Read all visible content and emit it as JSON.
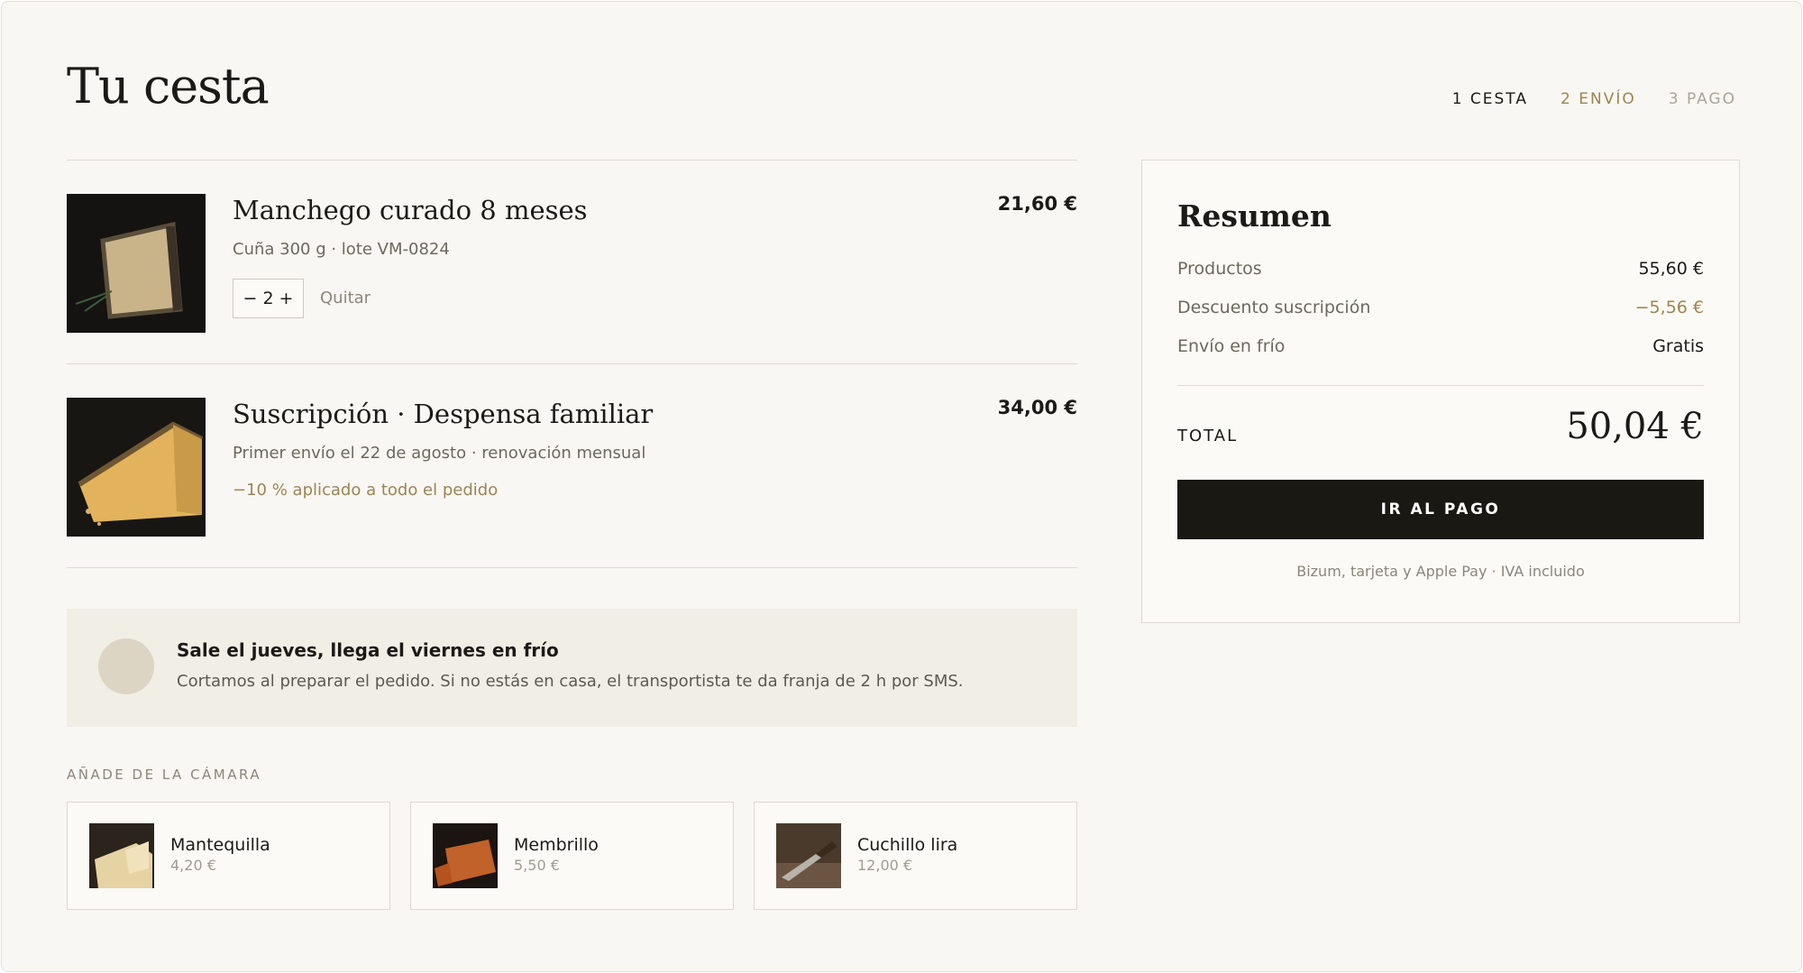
{
  "header": {
    "title": "Tu cesta",
    "steps": [
      "1 CESTA",
      "2 ENVÍO",
      "3 PAGO"
    ]
  },
  "items": [
    {
      "name": "Manchego curado 8 meses",
      "price": "21,60 €",
      "meta": "Cuña 300 g · lote VM-0824",
      "qty_minus": "−",
      "qty_value": "2",
      "qty_plus": "+",
      "remove_label": "Quitar"
    },
    {
      "name": "Suscripción · Despensa familiar",
      "price": "34,00 €",
      "meta": "Primer envío el 22 de agosto · renovación mensual",
      "note": "−10 % aplicado a todo el pedido"
    }
  ],
  "delivery": {
    "title": "Sale el jueves, llega el viernes en frío",
    "text": "Cortamos al preparar el pedido. Si no estás en casa, el transportista te da franja de 2 h por SMS."
  },
  "addons": {
    "label": "AÑADE DE LA CÁMARA",
    "items": [
      {
        "name": "Mantequilla",
        "price": "4,20 €"
      },
      {
        "name": "Membrillo",
        "price": "5,50 €"
      },
      {
        "name": "Cuchillo lira",
        "price": "12,00 €"
      }
    ]
  },
  "summary": {
    "title": "Resumen",
    "rows": [
      {
        "label": "Productos",
        "value": "55,60 €"
      },
      {
        "label": "Descuento suscripción",
        "value": "−5,56 €"
      },
      {
        "label": "Envío en frío",
        "value": "Gratis"
      }
    ],
    "total_label": "TOTAL",
    "total_value": "50,04 €",
    "pay_button": "IR AL PAGO",
    "pay_note": "Bizum, tarjeta y Apple Pay · IVA incluido"
  },
  "colors": {
    "accent_gold": "#9c8550",
    "button_dark": "#1a1812",
    "background": "#f9f7f3"
  }
}
